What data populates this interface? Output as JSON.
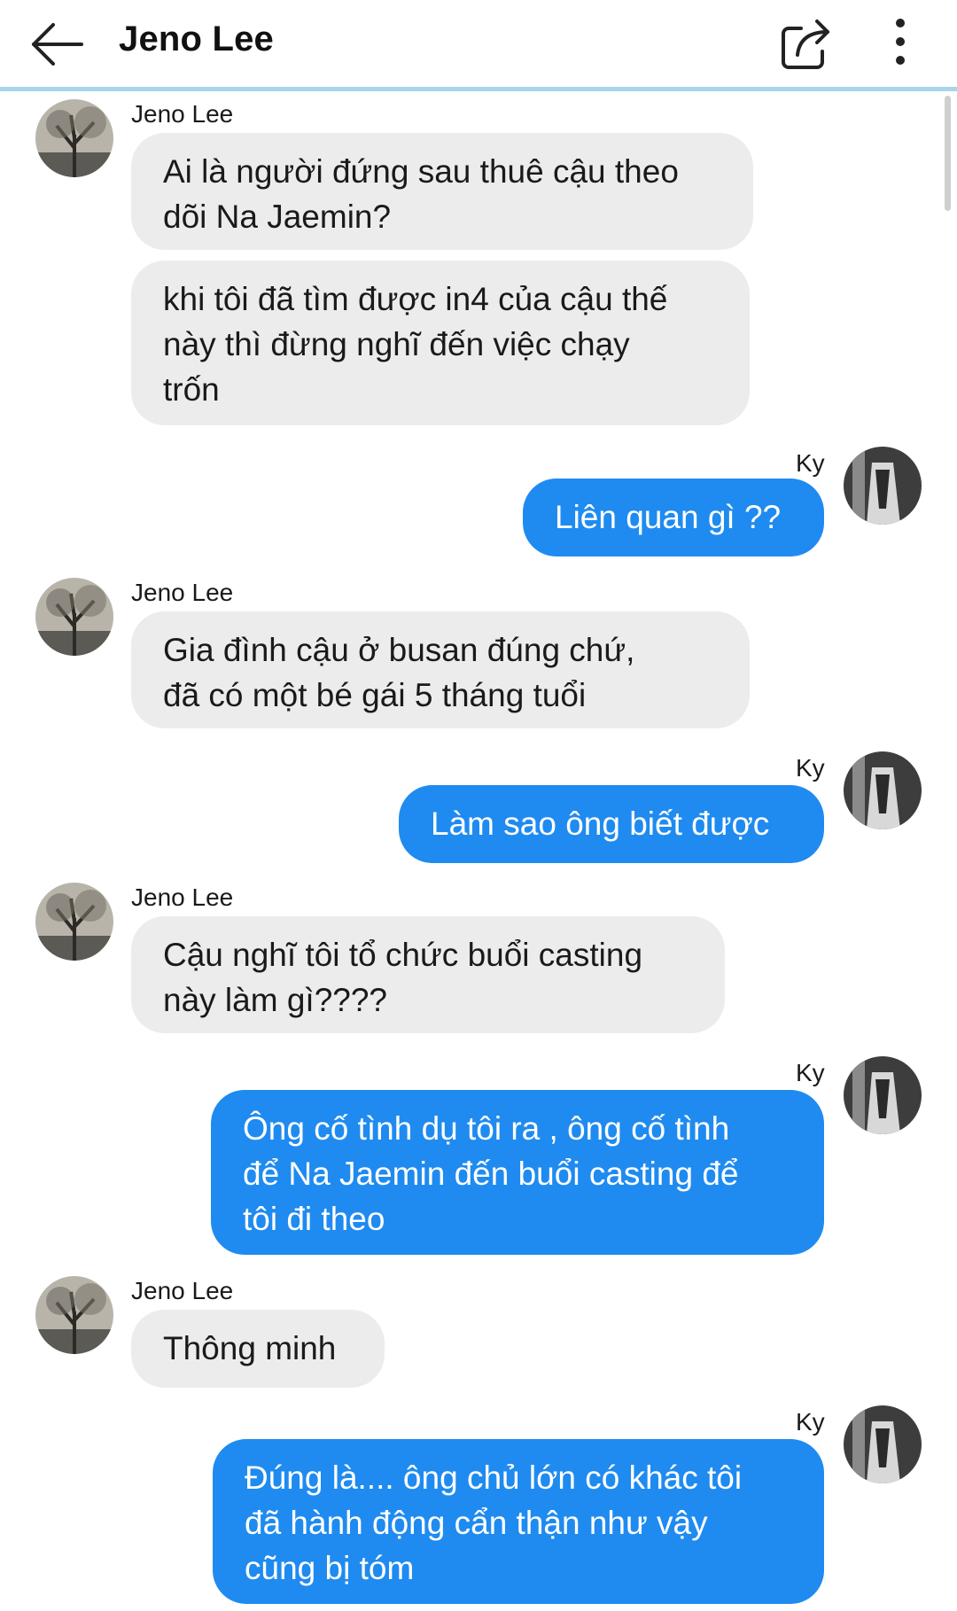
{
  "header": {
    "title": "Jeno Lee",
    "back_icon": "arrow-left-icon",
    "share_icon": "share-icon",
    "more_icon": "more-vertical-icon"
  },
  "colors": {
    "outgoing_bubble": "#1f8bf0",
    "incoming_bubble": "#ececed",
    "header_divider": "#a9d4ee"
  },
  "messages": [
    {
      "sender": "Jeno Lee",
      "bubbles": [
        "Ai là người đứng sau thuê cậu theo\ndõi Na Jaemin?",
        "khi tôi đã tìm được in4 của cậu thế\nnày thì đừng nghĩ đến việc chạy\ntrốn"
      ]
    },
    {
      "sender": "Ky",
      "bubbles": [
        "Liên quan gì ??"
      ]
    },
    {
      "sender": "Jeno Lee",
      "bubbles": [
        "Gia đình cậu ở busan đúng chứ,\n      đã có một bé gái 5 tháng tuổi"
      ]
    },
    {
      "sender": "Ky",
      "bubbles": [
        "Làm sao ông biết được"
      ]
    },
    {
      "sender": "Jeno Lee",
      "bubbles": [
        "Cậu nghĩ tôi tổ chức buổi casting\nnày làm gì????"
      ]
    },
    {
      "sender": "Ky",
      "bubbles": [
        "Ông cố tình dụ tôi ra , ông cố tình\nđể Na Jaemin đến buổi casting để\ntôi đi theo"
      ]
    },
    {
      "sender": "Jeno Lee",
      "bubbles": [
        "Thông minh"
      ]
    },
    {
      "sender": "Ky",
      "bubbles": [
        "Đúng là.... ông chủ lớn có khác tôi\nđã hành động cẩn thận như vậy\ncũng bị tóm"
      ]
    }
  ]
}
